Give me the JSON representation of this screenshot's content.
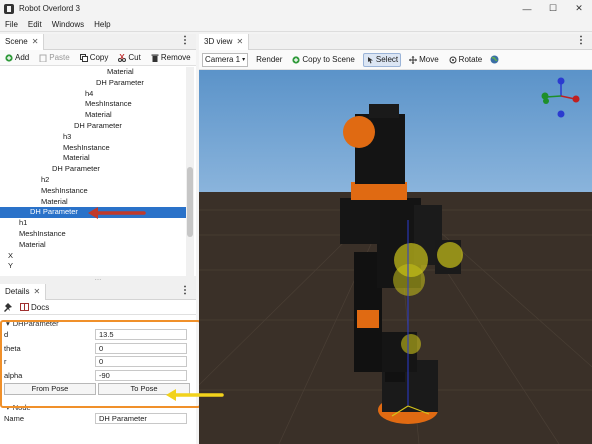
{
  "window": {
    "title": "Robot Overlord 3",
    "minimize": "—",
    "maximize": "☐",
    "close": "✕"
  },
  "menu": [
    "File",
    "Edit",
    "Windows",
    "Help"
  ],
  "scene_panel": {
    "tab": "Scene",
    "toolbar": {
      "add": "Add",
      "paste": "Paste",
      "copy": "Copy",
      "cut": "Cut",
      "remove": "Remove"
    },
    "tree": [
      {
        "label": "Material",
        "indent": 7
      },
      {
        "label": "DH Parameter",
        "indent": 6
      },
      {
        "label": "h4",
        "indent": 5
      },
      {
        "label": "MeshInstance",
        "indent": 5
      },
      {
        "label": "Material",
        "indent": 5
      },
      {
        "label": "DH Parameter",
        "indent": 4
      },
      {
        "label": "h3",
        "indent": 3
      },
      {
        "label": "MeshInstance",
        "indent": 3
      },
      {
        "label": "Material",
        "indent": 3
      },
      {
        "label": "DH Parameter",
        "indent": 2
      },
      {
        "label": "h2",
        "indent": 1
      },
      {
        "label": "MeshInstance",
        "indent": 1
      },
      {
        "label": "Material",
        "indent": 1
      },
      {
        "label": "DH Parameter",
        "indent": 0,
        "selected": true
      },
      {
        "label": "h1",
        "indent": -1
      },
      {
        "label": "MeshInstance",
        "indent": -1
      },
      {
        "label": "Material",
        "indent": -1
      },
      {
        "label": "X",
        "indent": -2
      },
      {
        "label": "Y",
        "indent": -2
      }
    ]
  },
  "details_panel": {
    "tab": "Details",
    "docs": "Docs",
    "section_dh": "DHParameter",
    "props": [
      {
        "label": "d",
        "value": "13.5"
      },
      {
        "label": "theta",
        "value": "0"
      },
      {
        "label": "r",
        "value": "0"
      },
      {
        "label": "alpha",
        "value": "-90"
      }
    ],
    "from_pose": "From Pose",
    "to_pose": "To Pose",
    "section_node": "Node",
    "name_label": "Name",
    "name_value": "DH Parameter"
  },
  "view_panel": {
    "tab": "3D view",
    "camera": "Camera 1",
    "render": "Render",
    "copy_to_scene": "Copy to Scene",
    "select": "Select",
    "move": "Move",
    "rotate": "Rotate"
  },
  "colors": {
    "highlight_orange": "#f0902a",
    "arrow_red": "#c0392b",
    "arrow_yellow": "#f2d21b",
    "selection_blue": "#2a72c9",
    "sky": "#5f97cd",
    "floor": "#3a3028"
  }
}
